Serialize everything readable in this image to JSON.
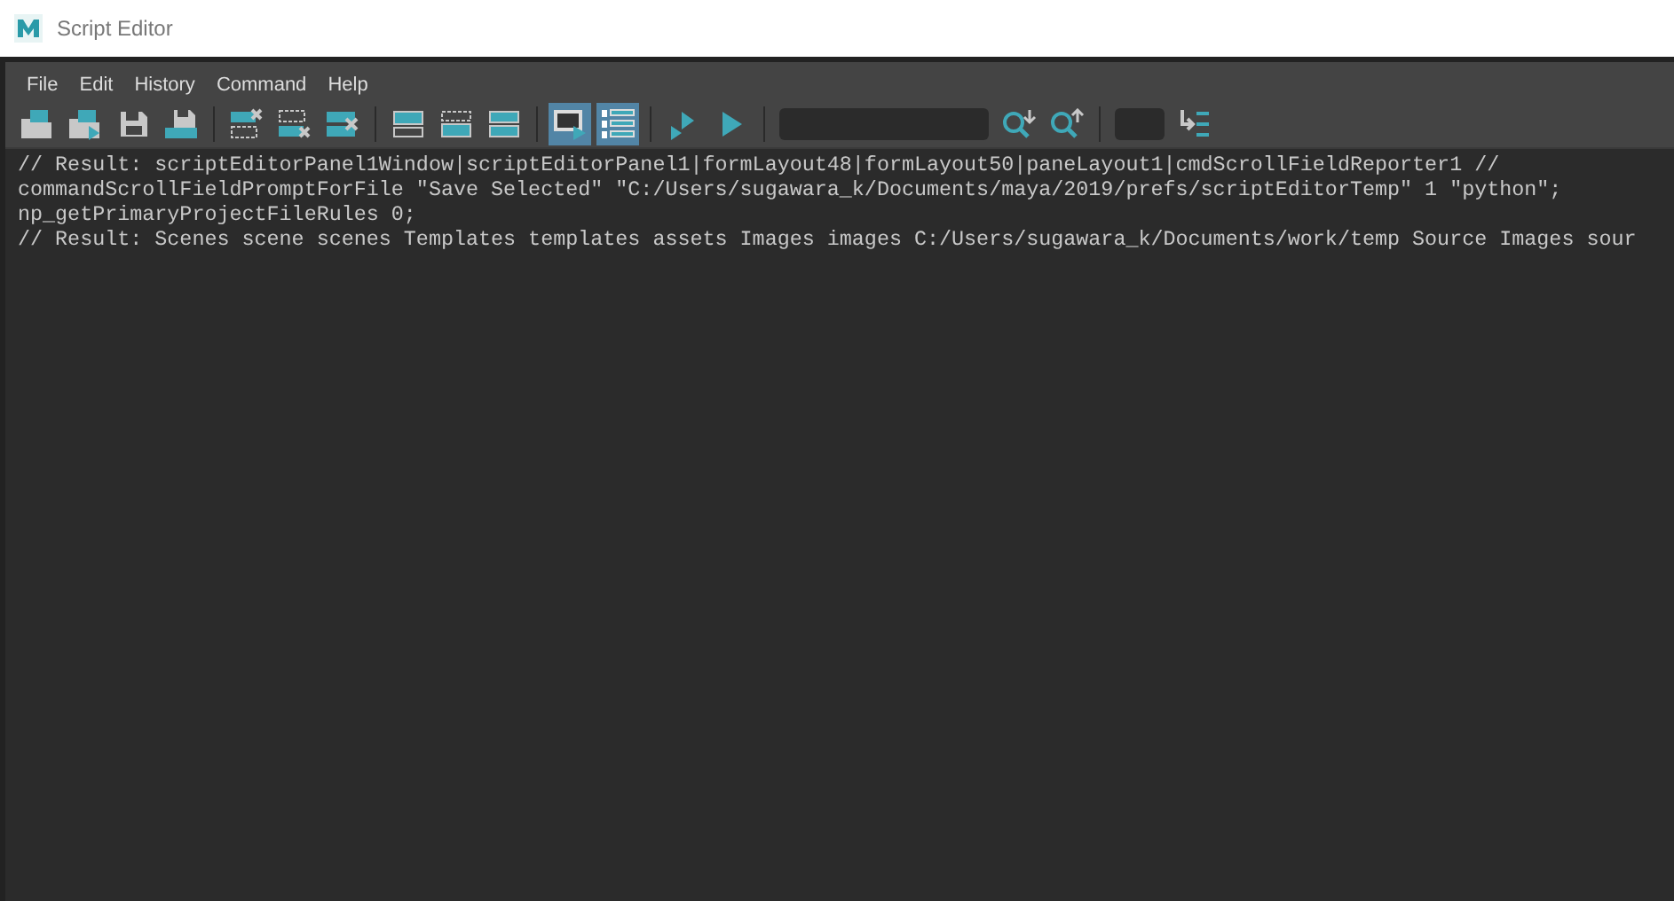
{
  "window": {
    "title": "Script Editor"
  },
  "menu": [
    "File",
    "Edit",
    "History",
    "Command",
    "Help"
  ],
  "toolbar": [
    {
      "kind": "button",
      "selected": false
    },
    {
      "kind": "button",
      "selected": false
    },
    {
      "kind": "button",
      "selected": false
    },
    {
      "kind": "button",
      "selected": false
    },
    {
      "kind": "separator"
    },
    {
      "kind": "button",
      "selected": false
    },
    {
      "kind": "button",
      "selected": false
    },
    {
      "kind": "button",
      "selected": false
    },
    {
      "kind": "separator"
    },
    {
      "kind": "button",
      "selected": false
    },
    {
      "kind": "button",
      "selected": false
    },
    {
      "kind": "button",
      "selected": false
    },
    {
      "kind": "separator"
    },
    {
      "kind": "button",
      "selected": true
    },
    {
      "kind": "button",
      "selected": true
    },
    {
      "kind": "separator"
    },
    {
      "kind": "button",
      "selected": false
    },
    {
      "kind": "button",
      "selected": false
    },
    {
      "kind": "separator"
    },
    {
      "kind": "search"
    },
    {
      "kind": "button",
      "selected": false
    },
    {
      "kind": "button",
      "selected": false
    },
    {
      "kind": "separator"
    },
    {
      "kind": "linefield"
    },
    {
      "kind": "button",
      "selected": false
    }
  ],
  "output": [
    "// Result: scriptEditorPanel1Window|scriptEditorPanel1|formLayout48|formLayout50|paneLayout1|cmdScrollFieldReporter1 //",
    "commandScrollFieldPromptForFile \"Save Selected\" \"C:/Users/sugawara_k/Documents/maya/2019/prefs/scriptEditorTemp\" 1 \"python\";",
    "np_getPrimaryProjectFileRules 0;",
    "// Result: Scenes scene scenes Templates templates assets Images images C:/Users/sugawara_k/Documents/work/temp Source Images sour"
  ]
}
